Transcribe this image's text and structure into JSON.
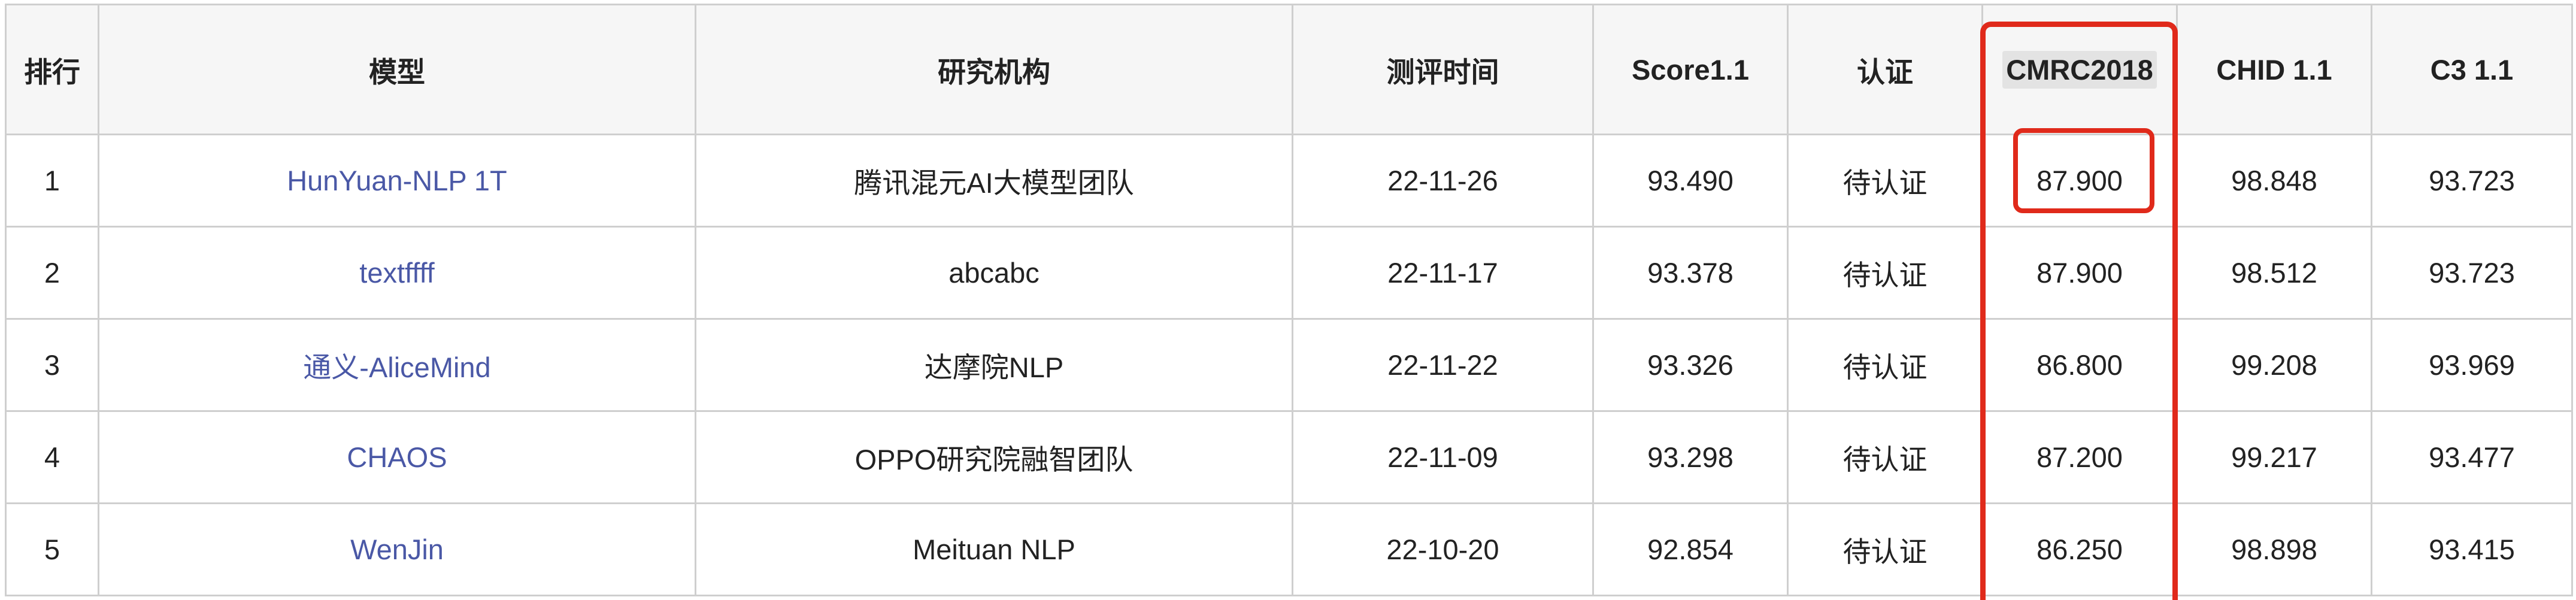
{
  "table": {
    "headers": [
      "排行",
      "模型",
      "研究机构",
      "测评时间",
      "Score1.1",
      "认证",
      "CMRC2018",
      "CHID 1.1",
      "C3 1.1"
    ],
    "rows": [
      [
        "1",
        "HunYuan-NLP 1T",
        "腾讯混元AI大模型团队",
        "22-11-26",
        "93.490",
        "待认证",
        "87.900",
        "98.848",
        "93.723"
      ],
      [
        "2",
        "textffff",
        "abcabc",
        "22-11-17",
        "93.378",
        "待认证",
        "87.900",
        "98.512",
        "93.723"
      ],
      [
        "3",
        "通义-AliceMind",
        "达摩院NLP",
        "22-11-22",
        "93.326",
        "待认证",
        "86.800",
        "99.208",
        "93.969"
      ],
      [
        "4",
        "CHAOS",
        "OPPO研究院融智团队",
        "22-11-09",
        "93.298",
        "待认证",
        "87.200",
        "99.217",
        "93.477"
      ],
      [
        "5",
        "WenJin",
        "Meituan NLP",
        "22-10-20",
        "92.854",
        "待认证",
        "86.250",
        "98.898",
        "93.415"
      ]
    ]
  },
  "colors": {
    "link": "#4a58a6",
    "top_score": "#e02020",
    "annotation": "#e02a1b",
    "border": "#cfcfcf",
    "header_bg": "#f6f6f6"
  }
}
